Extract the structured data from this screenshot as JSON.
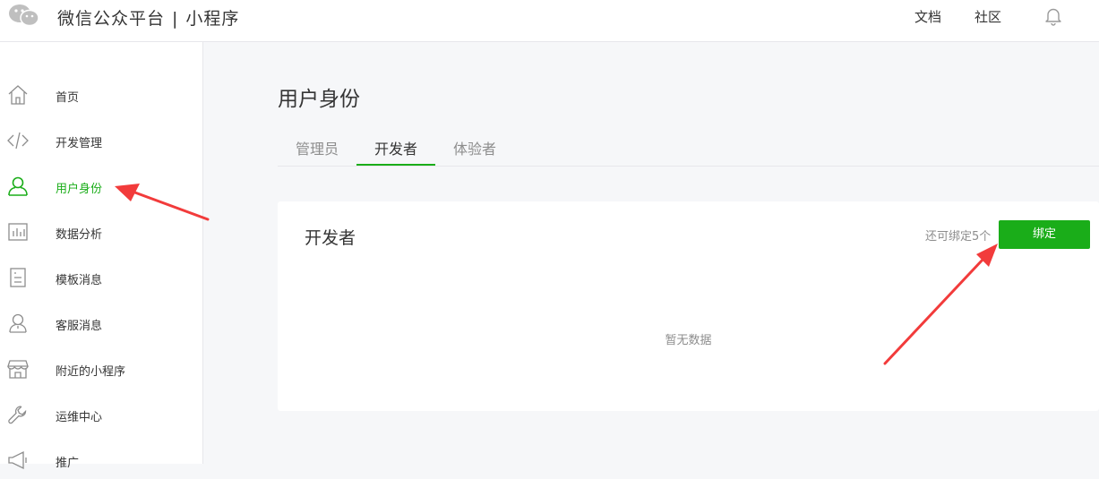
{
  "header": {
    "brand": "微信公众平台",
    "separator": "|",
    "product": "小程序",
    "links": {
      "docs": "文档",
      "community": "社区"
    }
  },
  "sidebar": {
    "items": [
      {
        "label": "首页",
        "icon": "home-icon"
      },
      {
        "label": "开发管理",
        "icon": "code-icon"
      },
      {
        "label": "用户身份",
        "icon": "user-icon",
        "active": true
      },
      {
        "label": "数据分析",
        "icon": "chart-icon"
      },
      {
        "label": "模板消息",
        "icon": "document-icon"
      },
      {
        "label": "客服消息",
        "icon": "support-icon"
      },
      {
        "label": "附近的小程序",
        "icon": "store-icon"
      },
      {
        "label": "运维中心",
        "icon": "wrench-icon"
      },
      {
        "label": "推广",
        "icon": "megaphone-icon"
      }
    ]
  },
  "main": {
    "title": "用户身份",
    "tabs": [
      {
        "label": "管理员"
      },
      {
        "label": "开发者",
        "active": true
      },
      {
        "label": "体验者"
      }
    ],
    "card": {
      "title": "开发者",
      "quota": "还可绑定5个",
      "bind_label": "绑定",
      "empty_text": "暂无数据"
    }
  },
  "colors": {
    "accent": "#1aad19",
    "annotation_arrow": "#f23b3b"
  }
}
